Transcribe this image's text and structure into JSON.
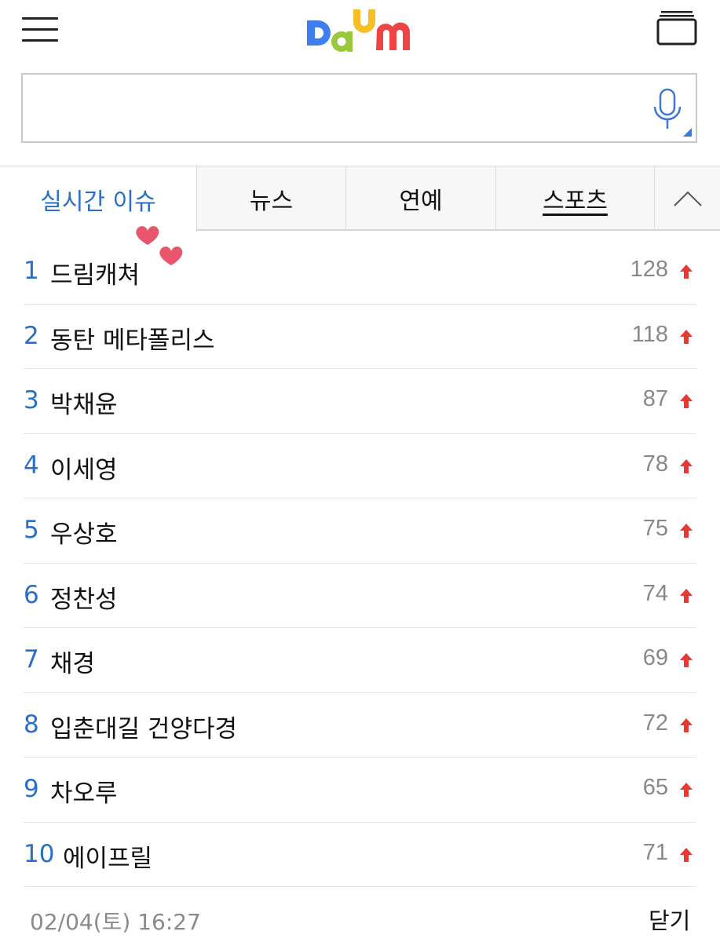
{
  "header": {
    "logo_text": "Daum",
    "menu_icon": "hamburger-menu-icon",
    "tabs_icon": "window-tabs-icon"
  },
  "search": {
    "value": "",
    "placeholder": "",
    "mic_icon": "microphone-icon"
  },
  "tabs": [
    {
      "label": "실시간 이슈",
      "active": true
    },
    {
      "label": "뉴스",
      "active": false
    },
    {
      "label": "연예",
      "active": false
    },
    {
      "label": "스포츠",
      "active": false
    }
  ],
  "collapse_icon": "chevron-up-icon",
  "issues": [
    {
      "rank": "1",
      "keyword": "드림캐쳐",
      "count": "128",
      "trend": "up"
    },
    {
      "rank": "2",
      "keyword": "동탄 메타폴리스",
      "count": "118",
      "trend": "up"
    },
    {
      "rank": "3",
      "keyword": "박채윤",
      "count": "87",
      "trend": "up"
    },
    {
      "rank": "4",
      "keyword": "이세영",
      "count": "78",
      "trend": "up"
    },
    {
      "rank": "5",
      "keyword": "우상호",
      "count": "75",
      "trend": "up"
    },
    {
      "rank": "6",
      "keyword": "정찬성",
      "count": "74",
      "trend": "up"
    },
    {
      "rank": "7",
      "keyword": "채경",
      "count": "69",
      "trend": "up"
    },
    {
      "rank": "8",
      "keyword": "입춘대길 건양다경",
      "count": "72",
      "trend": "up"
    },
    {
      "rank": "9",
      "keyword": "차오루",
      "count": "65",
      "trend": "up"
    },
    {
      "rank": "10",
      "keyword": "에이프릴",
      "count": "71",
      "trend": "up"
    }
  ],
  "footer": {
    "timestamp": "02/04(토) 16:27",
    "close_label": "닫기"
  },
  "colors": {
    "accent_blue": "#2b6fc4",
    "trend_up_red": "#e53935",
    "heart_pink": "#e8566e"
  }
}
